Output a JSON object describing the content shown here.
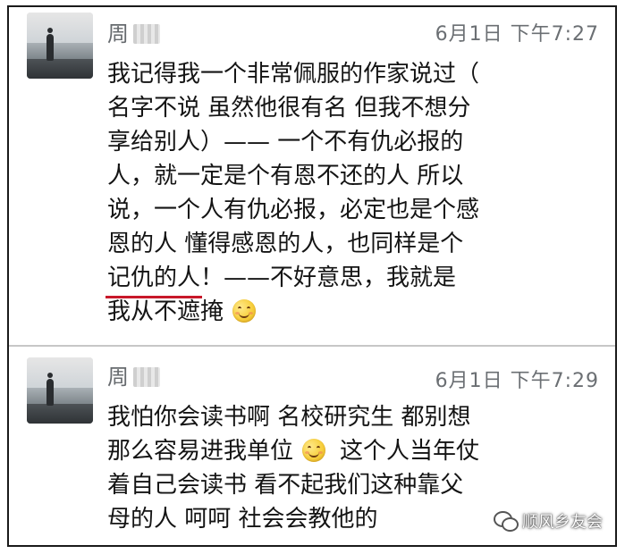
{
  "messages": [
    {
      "sender": "周",
      "time": "6月1日 下午7:27",
      "lines": [
        "我记得我一个非常佩服的作家说过（",
        "名字不说 虽然他很有名 但我不想分",
        "享给别人）——  一个不有仇必报的",
        "人，就一定是个有恩不还的人  所以",
        "说，一个人有仇必报，必定也是个感",
        "恩的人  懂得感恩的人，也同样是个"
      ],
      "line7_underlined": "记仇的人",
      "line7_rest": "！——不好意思，我就是",
      "line8": "我从不遮掩",
      "emoji": "smile-emoji"
    },
    {
      "sender": "周",
      "time": "6月1日 下午7:29",
      "line1": "我怕你会读书啊  名校研究生 都别想",
      "line2_before": "那么容易进我单位",
      "line2_after": "这个人当年仗",
      "line3": "着自己会读书  看不起我们这种靠父",
      "line4": "母的人   呵呵 社会会教他的",
      "emoji": "smile-emoji"
    }
  ],
  "watermark": {
    "text": "顺风乡友会",
    "icon": "wechat-icon"
  },
  "colors": {
    "underline": "#c8182a",
    "meta_text": "#6b6f73",
    "body_text": "#141414",
    "divider": "#c7c7c7"
  }
}
